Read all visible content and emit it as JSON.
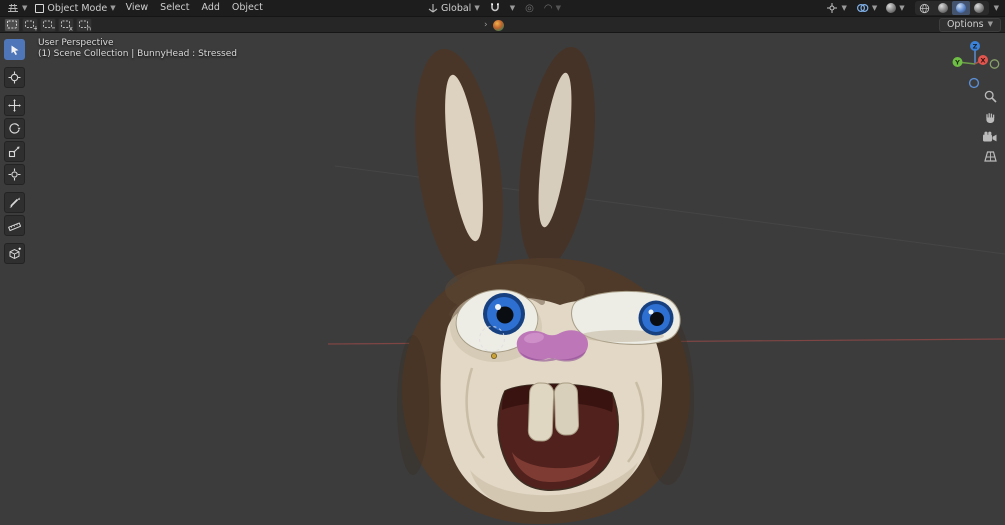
{
  "header": {
    "editor_icon": "3d-viewport-editor-icon",
    "mode_select": {
      "label": "Object Mode"
    },
    "menus": [
      {
        "label": "View"
      },
      {
        "label": "Select"
      },
      {
        "label": "Add"
      },
      {
        "label": "Object"
      }
    ],
    "orientation": {
      "label": "Global"
    },
    "right_icons": [
      "show-gizmo",
      "show-overlays",
      "toggle-xray",
      "shading-wireframe",
      "shading-solid",
      "shading-material",
      "shading-rendered"
    ]
  },
  "tool_settings": {
    "select_modes": [
      "set",
      "extend",
      "subtract",
      "invert",
      "intersect"
    ],
    "select_mode_marks": {
      "extend": "+",
      "subtract": "−",
      "invert": "x",
      "intersect": "∩"
    },
    "options_label": "Options"
  },
  "toolbar": {
    "tools": [
      "select-box",
      "cursor",
      "move",
      "rotate",
      "scale",
      "transform",
      "annotate",
      "measure",
      "add-cube"
    ],
    "active_tool": "select-box"
  },
  "viewport": {
    "overlay": {
      "line1": "User Perspective",
      "line2": "(1) Scene Collection | BunnyHead : Stressed"
    },
    "gizmo_axes": {
      "x": "X",
      "y": "Y",
      "z": "Z"
    },
    "colors": {
      "background": "#3c3c3c",
      "header": "#1d1d1d",
      "accent": "#4772b3",
      "axis_x_line": "#9a4a48",
      "gizmo_x": "#e0564f",
      "gizmo_y": "#6fbe45",
      "gizmo_z": "#3b82d8"
    },
    "bunny": {
      "fur": "#4f3a2a",
      "inner_ear": "#dcd2bf",
      "face": "#e2d8c5",
      "eye_white": "#edece5",
      "iris": "#2e6fd2",
      "pupil": "#0a0d12",
      "nose": "#bd77b8",
      "mouth": "#4e1e1a",
      "teeth": "#e0d7c3"
    }
  }
}
